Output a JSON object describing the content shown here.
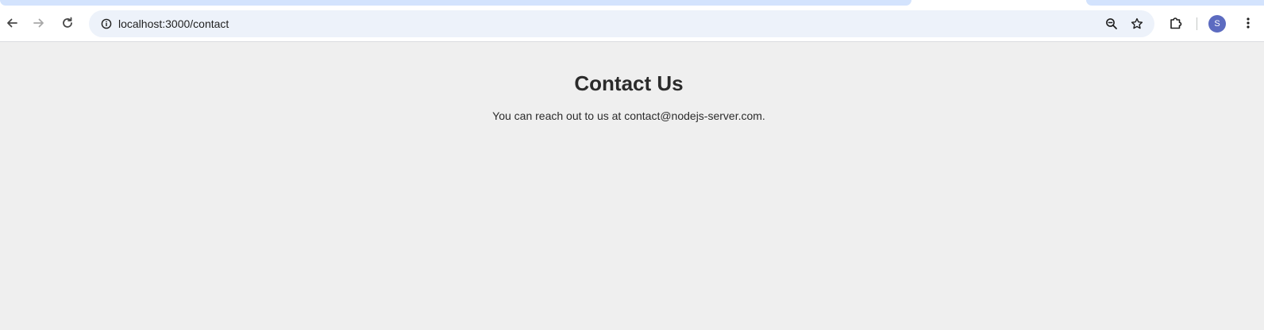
{
  "browser": {
    "url": "localhost:3000/contact",
    "profile_initial": "S",
    "icons": {
      "back": "arrow-left-icon",
      "forward": "arrow-right-icon",
      "reload": "reload-icon",
      "site_info": "info-icon",
      "zoom": "zoom-out-icon",
      "bookmark": "star-icon",
      "extensions": "puzzle-icon",
      "menu": "kebab-menu-icon"
    },
    "colors": {
      "tab_strip": "#d3e3fd",
      "omnibox": "#edf2fa",
      "avatar": "#5c6bc0"
    }
  },
  "page": {
    "title": "Contact Us",
    "text": "You can reach out to us at contact@nodejs-server.com.",
    "background": "#efefef"
  }
}
